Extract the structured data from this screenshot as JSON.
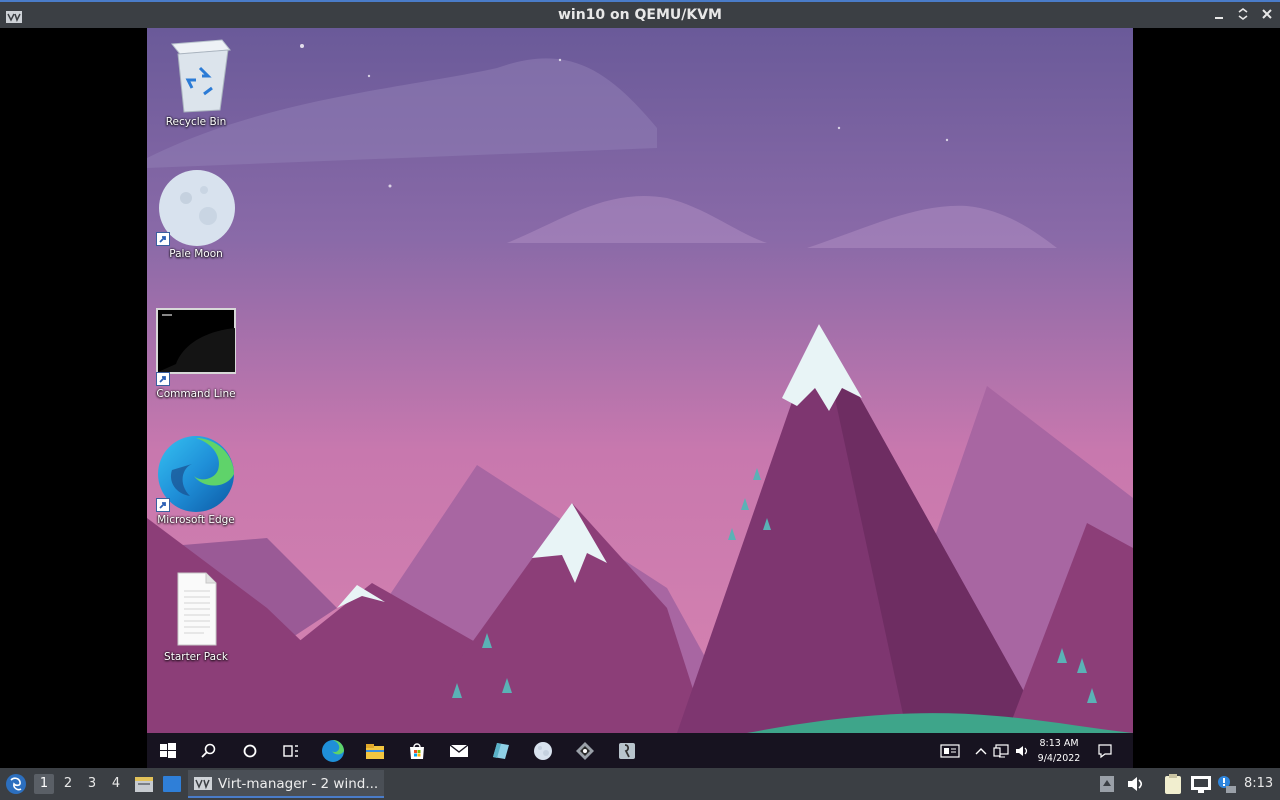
{
  "host_window": {
    "title": "win10 on QEMU/KVM"
  },
  "desktop_icons": [
    {
      "label": "Recycle Bin",
      "icon": "recycle-bin-icon"
    },
    {
      "label": "Pale Moon",
      "icon": "pale-moon-icon"
    },
    {
      "label": "Command Line",
      "icon": "command-line-icon"
    },
    {
      "label": "Microsoft Edge",
      "icon": "edge-icon"
    },
    {
      "label": "Starter Pack",
      "icon": "document-icon"
    }
  ],
  "win_taskbar": {
    "apps": [
      "start-icon",
      "search-icon",
      "cortana-icon",
      "task-view-icon",
      "edge-icon",
      "file-explorer-icon",
      "store-icon",
      "mail-icon",
      "app-icon",
      "pale-moon-icon",
      "app-icon",
      "app-icon"
    ],
    "clock_time": "8:13 AM",
    "clock_date": "9/4/2022"
  },
  "host_panel": {
    "workspaces": [
      "1",
      "2",
      "3",
      "4"
    ],
    "active_workspace": "1",
    "task_label": "Virt-manager - 2 wind...",
    "clock": "8:13"
  },
  "colors": {
    "wallpaper_top": "#6e5a9a",
    "wallpaper_pink": "#d47cad",
    "mountain": "#8c3e78",
    "taskbar": "#171320",
    "host_panel": "#3b3f44"
  }
}
